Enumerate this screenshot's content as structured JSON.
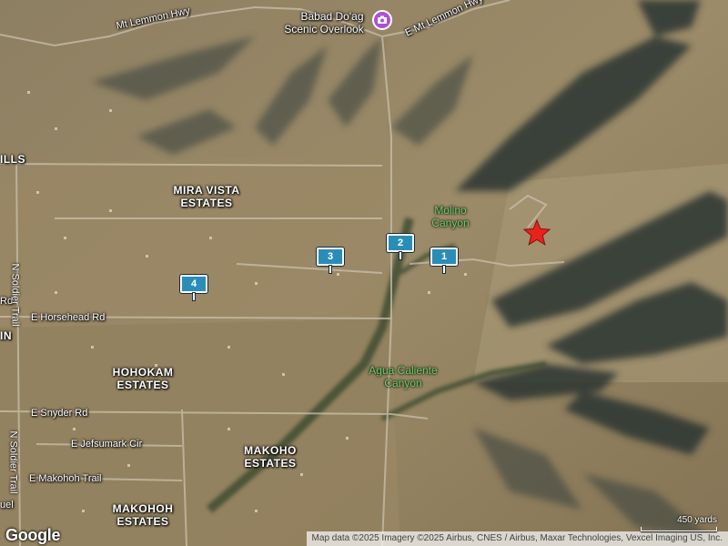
{
  "labels": {
    "mt_lemmon_hwy": "Mt Lemmon Hwy",
    "e_mt_lemmon_hwy": "E Mt Lemmon Hwy",
    "overlook_line1": "Babad Do'ag",
    "overlook_line2": "Scenic Overlook",
    "hills": "ILLS",
    "mira_vista_line1": "MIRA VISTA",
    "mira_vista_line2": "ESTATES",
    "molino_line1": "Molino",
    "molino_line2": "Canyon",
    "horsehead": "E Horsehead Rd",
    "rd_fragment": "Rd",
    "in_fragment": "IN",
    "hohokam_line1": "HOHOKAM",
    "hohokam_line2": "ESTATES",
    "agua_line1": "Agua Caliente",
    "agua_line2": "Canyon",
    "snyder": "E Snyder Rd",
    "jefsumark": "E Jefsumark Cir",
    "makohoh_trail": "E Makohoh Trail",
    "makoho_line1": "MAKOHO",
    "makoho_line2": "ESTATES",
    "makohoh_line1": "MAKOHOH",
    "makohoh_line2": "ESTATES",
    "soldier_trail_1": "N Soldier Trail",
    "soldier_trail_2": "N Soldier Trail",
    "quel_fragment": "uel"
  },
  "markers": [
    {
      "number": "1"
    },
    {
      "number": "2"
    },
    {
      "number": "3"
    },
    {
      "number": "4"
    }
  ],
  "logo": "Google",
  "attribution": "Map data ©2025 Imagery ©2025 Airbus, CNES / Airbus, Maxar Technologies, Vexcel Imaging US, Inc.",
  "scale": "450 yards",
  "icons": {
    "poi": "camera-icon",
    "destination": "star-icon"
  },
  "colors": {
    "marker": "#2a8db8",
    "star": "#e8231c",
    "poi": "#b04fd6",
    "park_label": "#6bd36b"
  }
}
